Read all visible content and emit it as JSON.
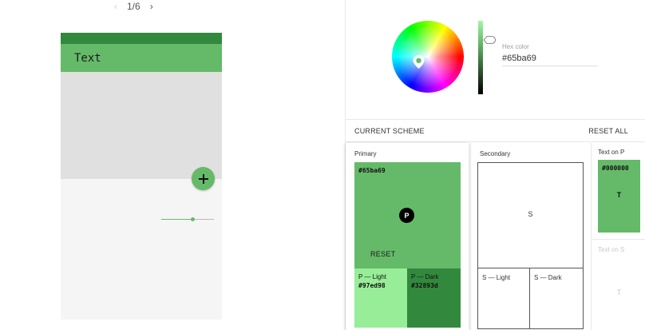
{
  "pager": {
    "prev_icon": "chevron-left-icon",
    "page": "1/6",
    "next_icon": "chevron-right-icon"
  },
  "preview": {
    "app_bar_title": "Text",
    "fab_icon": "plus-icon",
    "slider_value": 0.6,
    "colors": {
      "status_bar": "#32893d",
      "app_bar": "#65ba69",
      "content": "#e0e0e0",
      "background": "#f5f5f5"
    }
  },
  "picker": {
    "hex_label": "Hex color",
    "hex_value": "#65ba69",
    "wheel_marker_icon": "map-pin-icon"
  },
  "scheme": {
    "title": "CURRENT SCHEME",
    "reset_all": "RESET ALL",
    "primary": {
      "label": "Primary",
      "hex": "#65ba69",
      "badge": "P",
      "reset": "RESET",
      "light": {
        "name": "P — Light",
        "hex": "#97ed98"
      },
      "dark": {
        "name": "P — Dark",
        "hex": "#32893d"
      }
    },
    "secondary": {
      "label": "Secondary",
      "letter": "S",
      "light": {
        "name": "S — Light"
      },
      "dark": {
        "name": "S — Dark"
      }
    },
    "text_on_p": {
      "label": "Text on P",
      "hex": "#000000",
      "letter": "T"
    },
    "text_on_s": {
      "label": "Text on S",
      "letter": "T"
    }
  }
}
